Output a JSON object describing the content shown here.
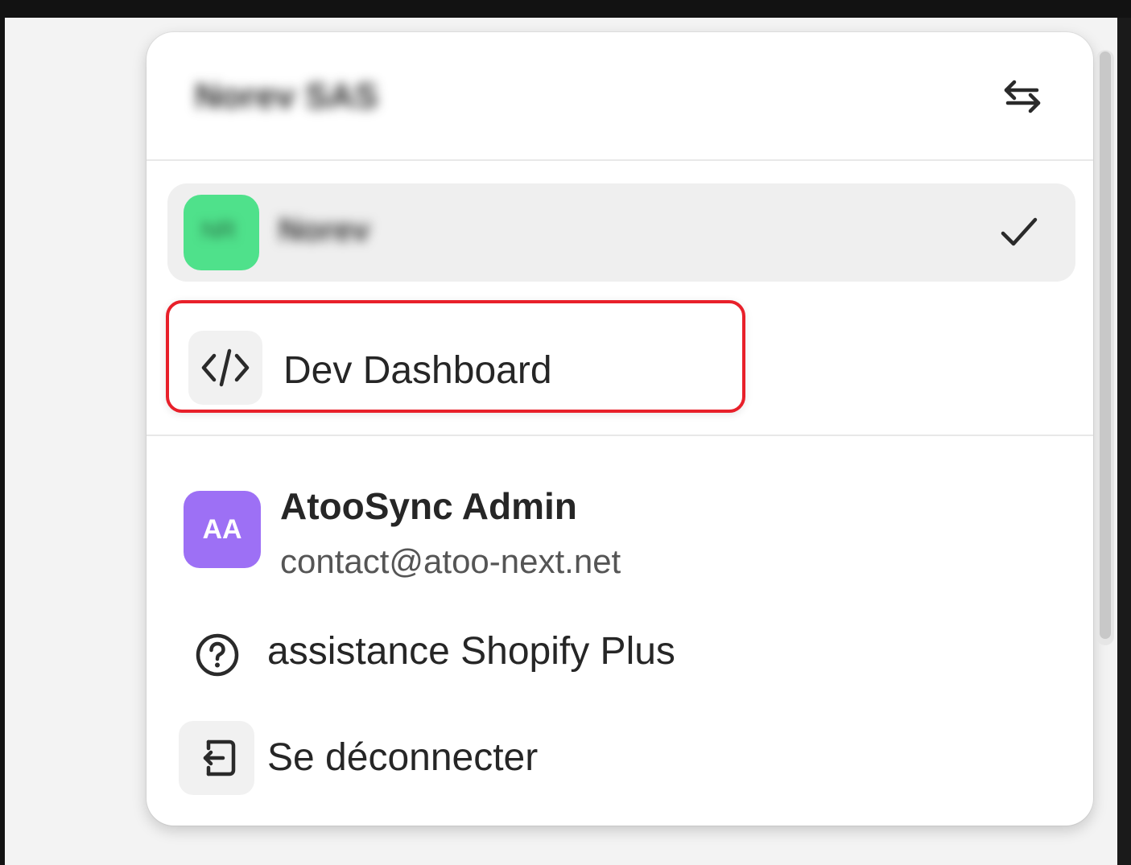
{
  "header": {
    "organization_name": "Norev SAS",
    "switch_icon": "arrows-left-right-icon"
  },
  "store": {
    "avatar_initials": "NR",
    "avatar_color": "#4fe18b",
    "name": "Norev",
    "selected": true,
    "check_icon": "checkmark-icon"
  },
  "dev_dashboard": {
    "icon": "code-icon",
    "label": "Dev Dashboard",
    "highlight_color": "#e8202a"
  },
  "user": {
    "initials": "AA",
    "avatar_color": "#9d70f5",
    "name": "AtooSync Admin",
    "email": "contact@atoo-next.net"
  },
  "support": {
    "icon": "question-circle-icon",
    "label": "assistance Shopify Plus"
  },
  "logout": {
    "icon": "logout-icon",
    "label": "Se déconnecter"
  }
}
